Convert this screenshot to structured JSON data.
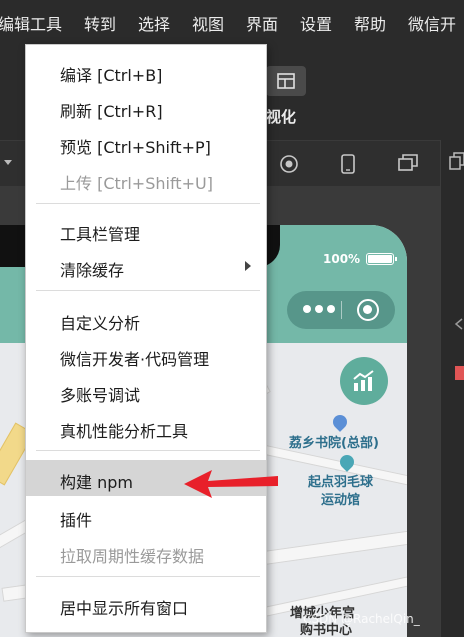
{
  "menubar": {
    "items": [
      "编辑",
      "工具",
      "转到",
      "选择",
      "视图",
      "界面",
      "设置",
      "帮助",
      "微信开"
    ]
  },
  "toolbar": {
    "visualize_label": "视化"
  },
  "simulator": {
    "battery_text": "100%"
  },
  "map": {
    "poi_bookstore": "荔乡书院(总部)",
    "poi_badminton_line1": "起点羽毛球",
    "poi_badminton_line2": "运动馆",
    "poi_youth_line1": "增城少年宫",
    "poi_youth_line2": "购书中心"
  },
  "dropdown": {
    "items": [
      {
        "label": "编译  [Ctrl+B]"
      },
      {
        "label": "刷新  [Ctrl+R]"
      },
      {
        "label": "预览  [Ctrl+Shift+P]"
      },
      {
        "label": "上传  [Ctrl+Shift+U]"
      },
      {
        "label": "工具栏管理"
      },
      {
        "label": "清除缓存"
      },
      {
        "label": "自定义分析"
      },
      {
        "label": "微信开发者·代码管理"
      },
      {
        "label": "多账号调试"
      },
      {
        "label": "真机性能分析工具"
      },
      {
        "label": "构建 npm"
      },
      {
        "label": "插件"
      },
      {
        "label": "拉取周期性缓存数据"
      },
      {
        "label": "居中显示所有窗口"
      }
    ]
  },
  "watermark": "CSDN @RachelQin_",
  "colors": {
    "menubar_bg": "#2b2b2b",
    "phone_header": "#74b8a8",
    "annotation_arrow": "#e8202a",
    "hover_bg": "#d5d5d5"
  }
}
